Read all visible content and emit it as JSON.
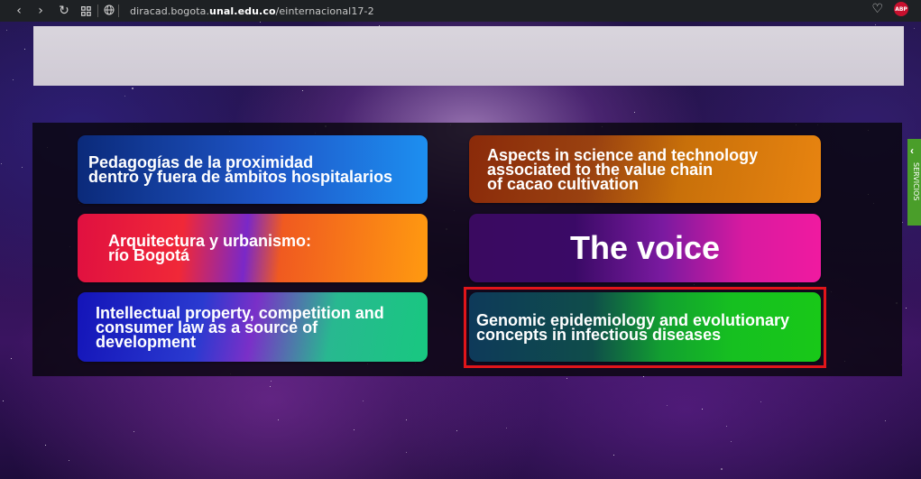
{
  "browser": {
    "url_prefix": "diracad.bogota.",
    "url_domain": "unal.edu.co",
    "url_path": "/einternacional17-2",
    "icons": [
      "back-icon",
      "forward-icon",
      "reload-icon",
      "apps-icon",
      "globe-icon",
      "heart-icon",
      "adblock-icon"
    ],
    "adblock_label": "ABP"
  },
  "cards": [
    {
      "label": "Pedagogías de la proximidad\ndentro y fuera de ámbitos hospitalarios"
    },
    {
      "label": "Aspects in science and technology\nassociated to the value chain\nof cacao cultivation"
    },
    {
      "label": "Arquitectura y urbanismo:\nrío Bogotá"
    },
    {
      "label": "The voice"
    },
    {
      "label": "Intellectual property, competition and\nconsumer law as a source of\ndevelopment"
    },
    {
      "label": "Genomic epidemiology and evolutionary\nconcepts in infectious diseases"
    }
  ],
  "side_tab": {
    "label": "SERVICIOS"
  },
  "colors": {
    "highlight": "#e1151a",
    "side_tab": "#4a9e2a",
    "browser_bar": "#1e2124"
  }
}
